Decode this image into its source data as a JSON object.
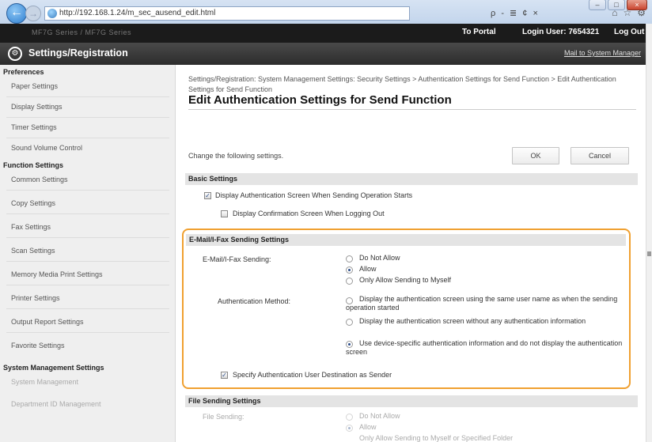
{
  "browser": {
    "url": "http://192.168.1.24/m_sec_ausend_edit.html",
    "address_tools": "ρ - ≣ ¢ ×",
    "nav_icons": [
      "home-icon",
      "star-icon",
      "gear-icon"
    ]
  },
  "topbar": {
    "device": "MF7G Series / MF7G Series",
    "portal": "To Portal",
    "login": "Login User: 7654321",
    "logout": "Log Out"
  },
  "header": {
    "title": "Settings/Registration",
    "mail_link": "Mail to System Manager"
  },
  "sidebar": {
    "preferences": "Preferences",
    "pref_items": [
      "Paper Settings",
      "Display Settings",
      "Timer Settings",
      "Sound Volume Control"
    ],
    "function_settings": "Function Settings",
    "func_items": [
      "Common Settings",
      "Copy Settings",
      "Fax Settings",
      "Scan Settings",
      "Memory Media Print Settings",
      "Printer Settings",
      "Output Report Settings",
      "Favorite Settings"
    ],
    "system_management": "System Management Settings",
    "sys_items": [
      "System Management",
      "Department ID Management"
    ]
  },
  "main": {
    "breadcrumb": "Settings/Registration: System Management Settings: Security Settings > Authentication Settings for Send Function > Edit Authentication Settings for Send Function",
    "title": "Edit Authentication Settings for Send Function",
    "instruction": "Change the following settings.",
    "ok": "OK",
    "cancel": "Cancel",
    "basic": {
      "heading": "Basic Settings",
      "display_auth": "Display Authentication Screen When Sending Operation Starts",
      "display_confirm": "Display Confirmation Screen When Logging Out"
    },
    "email": {
      "heading": "E-Mail/I-Fax Sending Settings",
      "sending_label": "E-Mail/I-Fax Sending:",
      "opt_not_allow": "Do Not Allow",
      "opt_allow": "Allow",
      "opt_only_myself": "Only Allow Sending to Myself",
      "auth_label": "Authentication Method:",
      "auth_opt1": "Display the authentication screen using the same user name as when the sending operation started",
      "auth_opt2": "Display the authentication screen without any authentication information",
      "auth_opt3": "Use device-specific authentication information and do not display the authentication screen",
      "specify_dest": "Specify Authentication User Destination as Sender"
    },
    "file": {
      "heading": "File Sending Settings",
      "sending_label": "File Sending:",
      "opt_not_allow": "Do Not Allow",
      "opt_allow": "Allow",
      "opt_only": "Only Allow Sending to Myself or Specified Folder"
    }
  },
  "colors": {
    "highlight": "#f0a030",
    "header_bg": "#2c2c2c"
  }
}
